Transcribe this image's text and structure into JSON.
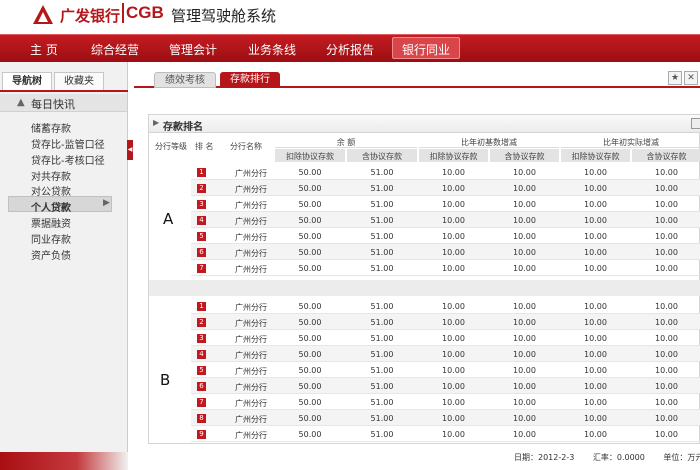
{
  "header": {
    "bank_cn": "广发银行",
    "bank_en": "CGB",
    "system_name": "管理驾驶舱系统"
  },
  "nav": {
    "items": [
      "主 页",
      "综合经营",
      "管理会计",
      "业务条线",
      "分析报告",
      "银行同业"
    ],
    "active_index": 5
  },
  "left": {
    "tabs": [
      "导航树",
      "收藏夹"
    ],
    "section_title": "每日快讯",
    "menu": [
      "储蓄存款",
      "贷存比-监管口径",
      "贷存比-考核口径",
      "对共存款",
      "对公贷款",
      "个人贷款",
      "票据融资",
      "同业存款",
      "资产负债"
    ],
    "active_menu_index": 5
  },
  "content": {
    "tabs": [
      "绩效考核",
      "存款排行"
    ],
    "active_tab_index": 1,
    "panel_title": "存款排名",
    "table": {
      "col_rank_level": "分行等级",
      "col_rank": "排 名",
      "col_branch": "分行名称",
      "groups": [
        "余 额",
        "比年初基数增减",
        "比年初实际增减"
      ],
      "sub_headers": [
        "扣除协议存款",
        "含协议存款",
        "扣除协议存款",
        "含协议存款",
        "扣除协议存款",
        "含协议存款"
      ],
      "section_a": {
        "label": "A",
        "rows": [
          {
            "rank": "1",
            "branch": "广州分行",
            "v": [
              "50.00",
              "51.00",
              "10.00",
              "10.00",
              "10.00",
              "10.00"
            ]
          },
          {
            "rank": "2",
            "branch": "广州分行",
            "v": [
              "50.00",
              "51.00",
              "10.00",
              "10.00",
              "10.00",
              "10.00"
            ]
          },
          {
            "rank": "3",
            "branch": "广州分行",
            "v": [
              "50.00",
              "51.00",
              "10.00",
              "10.00",
              "10.00",
              "10.00"
            ]
          },
          {
            "rank": "4",
            "branch": "广州分行",
            "v": [
              "50.00",
              "51.00",
              "10.00",
              "10.00",
              "10.00",
              "10.00"
            ]
          },
          {
            "rank": "5",
            "branch": "广州分行",
            "v": [
              "50.00",
              "51.00",
              "10.00",
              "10.00",
              "10.00",
              "10.00"
            ]
          },
          {
            "rank": "6",
            "branch": "广州分行",
            "v": [
              "50.00",
              "51.00",
              "10.00",
              "10.00",
              "10.00",
              "10.00"
            ]
          },
          {
            "rank": "7",
            "branch": "广州分行",
            "v": [
              "50.00",
              "51.00",
              "10.00",
              "10.00",
              "10.00",
              "10.00"
            ]
          }
        ]
      },
      "section_b": {
        "label": "B",
        "rows": [
          {
            "rank": "1",
            "branch": "广州分行",
            "v": [
              "50.00",
              "51.00",
              "10.00",
              "10.00",
              "10.00",
              "10.00"
            ]
          },
          {
            "rank": "2",
            "branch": "广州分行",
            "v": [
              "50.00",
              "51.00",
              "10.00",
              "10.00",
              "10.00",
              "10.00"
            ]
          },
          {
            "rank": "3",
            "branch": "广州分行",
            "v": [
              "50.00",
              "51.00",
              "10.00",
              "10.00",
              "10.00",
              "10.00"
            ]
          },
          {
            "rank": "4",
            "branch": "广州分行",
            "v": [
              "50.00",
              "51.00",
              "10.00",
              "10.00",
              "10.00",
              "10.00"
            ]
          },
          {
            "rank": "5",
            "branch": "广州分行",
            "v": [
              "50.00",
              "51.00",
              "10.00",
              "10.00",
              "10.00",
              "10.00"
            ]
          },
          {
            "rank": "6",
            "branch": "广州分行",
            "v": [
              "50.00",
              "51.00",
              "10.00",
              "10.00",
              "10.00",
              "10.00"
            ]
          },
          {
            "rank": "7",
            "branch": "广州分行",
            "v": [
              "50.00",
              "51.00",
              "10.00",
              "10.00",
              "10.00",
              "10.00"
            ]
          },
          {
            "rank": "8",
            "branch": "广州分行",
            "v": [
              "50.00",
              "51.00",
              "10.00",
              "10.00",
              "10.00",
              "10.00"
            ]
          },
          {
            "rank": "9",
            "branch": "广州分行",
            "v": [
              "50.00",
              "51.00",
              "10.00",
              "10.00",
              "10.00",
              "10.00"
            ]
          }
        ]
      }
    },
    "footer": {
      "date": "日期：2012-2-3",
      "rate": "汇率：0.0000",
      "unit": "单位：万元"
    }
  },
  "colors": {
    "brand": "#b51619",
    "rank_badge": "#c0191e"
  }
}
